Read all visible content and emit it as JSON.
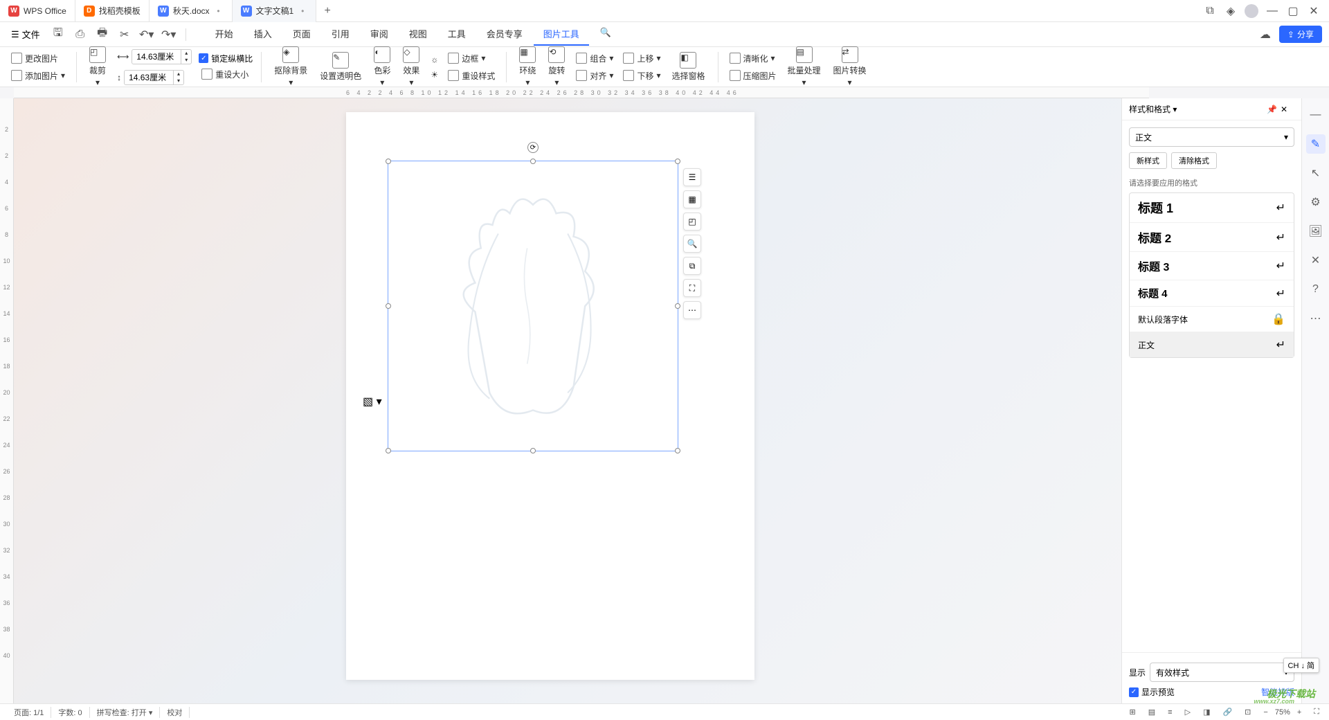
{
  "titlebar": {
    "app_name": "WPS Office",
    "tabs": [
      {
        "label": "找稻壳模板",
        "icon": "D"
      },
      {
        "label": "秋天.docx",
        "icon": "W"
      },
      {
        "label": "文字文稿1",
        "icon": "W"
      }
    ]
  },
  "menubar": {
    "file": "文件",
    "tabs": [
      "开始",
      "插入",
      "页面",
      "引用",
      "审阅",
      "视图",
      "工具",
      "会员专享",
      "图片工具"
    ],
    "share": "分享"
  },
  "ribbon": {
    "change_img": "更改图片",
    "add_img": "添加图片",
    "crop": "裁剪",
    "width": "14.63厘米",
    "height": "14.63厘米",
    "lock_ratio": "锁定纵横比",
    "reset_size": "重设大小",
    "remove_bg": "抠除背景",
    "set_transparent": "设置透明色",
    "color": "色彩",
    "effect": "效果",
    "border": "边框",
    "reset_style": "重设样式",
    "wrap": "环绕",
    "rotate": "旋转",
    "combine": "组合",
    "align": "对齐",
    "up": "上移",
    "down": "下移",
    "select_pane": "选择窗格",
    "sharpen": "清晰化",
    "compress": "压缩图片",
    "batch": "批量处理",
    "convert": "图片转换"
  },
  "ruler_h": "6 4 2  2 4 6 8 10 12 14 16 18 20 22 24 26 28 30 32 34 36 38 40 42 44 46",
  "ruler_v": [
    "2",
    "2",
    "4",
    "6",
    "8",
    "10",
    "12",
    "14",
    "16",
    "18",
    "20",
    "22",
    "24",
    "26",
    "28",
    "30",
    "32",
    "34",
    "36",
    "38",
    "40"
  ],
  "style_panel": {
    "title": "样式和格式",
    "current": "正文",
    "new_style": "新样式",
    "clear_format": "清除格式",
    "prompt": "请选择要应用的格式",
    "styles": [
      {
        "name": "标题 1"
      },
      {
        "name": "标题 2"
      },
      {
        "name": "标题 3"
      },
      {
        "name": "标题 4"
      },
      {
        "name": "默认段落字体",
        "light": true
      },
      {
        "name": "正文",
        "selected": true
      }
    ],
    "show_label": "显示",
    "show_value": "有效样式",
    "preview": "显示预览",
    "smart_layout": "智能排版"
  },
  "statusbar": {
    "page": "页面: 1/1",
    "words": "字数: 0",
    "spell": "拼写检查: 打开",
    "proof": "校对",
    "zoom": "75%"
  },
  "ime": "CH ↓ 简",
  "watermark": "极光下载站",
  "watermark_url": "www.xz7.com"
}
